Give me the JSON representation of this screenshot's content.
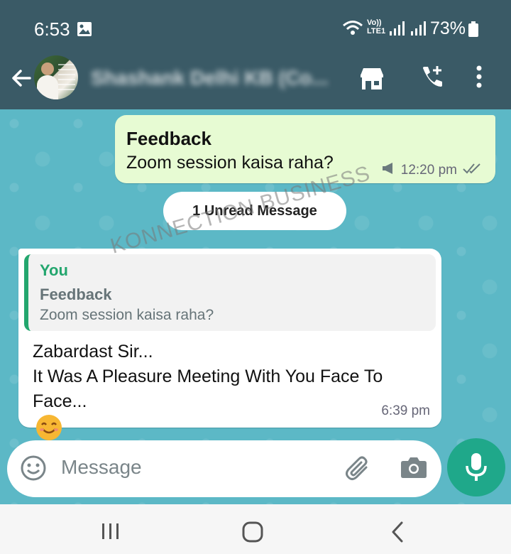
{
  "status_bar": {
    "time": "6:53",
    "network_label_top": "Vo))",
    "network_label_bottom": "LTE1",
    "battery": "73%"
  },
  "header": {
    "contact_name": "Shashank Delhi KB (Co..."
  },
  "messages": {
    "outgoing": {
      "title": "Feedback",
      "body": "Zoom session kaisa raha?",
      "time": "12:20 pm"
    },
    "unread_divider": "1 Unread Message",
    "watermark": "KONNECTION BUSINESS",
    "incoming": {
      "quote_author": "You",
      "quote_title": "Feedback",
      "quote_body": "Zoom session kaisa raha?",
      "line1": "Zabardast Sir...",
      "line2": "It Was A Pleasure Meeting With You Face To",
      "line3": "Face...",
      "time": "6:39 pm"
    }
  },
  "composer": {
    "placeholder": "Message"
  },
  "colors": {
    "header": "#3a5a66",
    "chat_bg": "#5cb8c6",
    "outgoing_bubble": "#e7fbd3",
    "accent_green": "#1fa88a",
    "quote_green": "#23a66e"
  },
  "icons": [
    "gallery-icon",
    "wifi-icon",
    "signal-icon",
    "battery-icon",
    "back-arrow-icon",
    "store-icon",
    "add-call-icon",
    "more-vert-icon",
    "megaphone-icon",
    "double-check-icon",
    "smiley-emoji",
    "emoji-icon",
    "attach-icon",
    "camera-icon",
    "mic-icon",
    "recent-apps-icon",
    "home-icon",
    "back-icon"
  ]
}
